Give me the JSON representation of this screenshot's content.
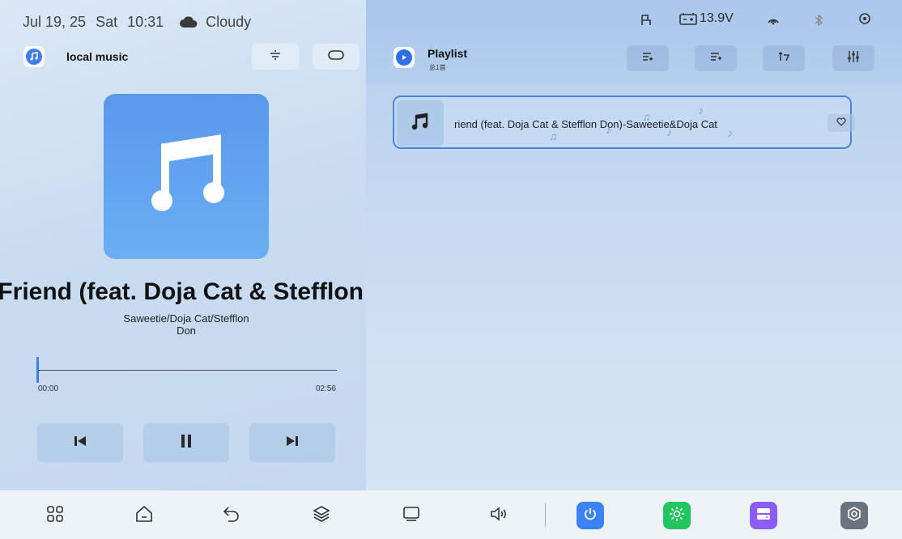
{
  "status_bar": {
    "date": "Jul 19, 25",
    "day": "Sat",
    "time": "10:31",
    "weather": "Cloudy",
    "voltage": "13.9V"
  },
  "left_header": {
    "title": "local music"
  },
  "right_header": {
    "title": "Playlist",
    "subtitle": "总1首"
  },
  "now_playing": {
    "title": "t Friend (feat. Doja Cat & Stefflon",
    "artist_line1": "Saweetie/Doja Cat/Stefflon",
    "artist_line2": "Don",
    "elapsed": "00:00",
    "duration": "02:56",
    "progress": 0.0
  },
  "playlist": {
    "items": [
      {
        "label": "riend (feat. Doja Cat & Stefflon Don)-Saweetie&Doja Cat"
      }
    ]
  },
  "icons": {
    "left_header": [
      "menu-lines-icon",
      "repeat-loop-icon"
    ],
    "right_header": [
      "favorite-list-icon",
      "add-list-icon",
      "sort-icon",
      "equalizer-icon"
    ],
    "transport": [
      "previous-icon",
      "pause-icon",
      "next-icon"
    ],
    "dock": [
      "apps-grid-icon",
      "home-icon",
      "back-icon",
      "layers-icon",
      "screen-icon",
      "volume-icon",
      "power-icon",
      "brightness-icon",
      "storage-icon",
      "settings-icon"
    ]
  },
  "colors": {
    "accent": "#3f7cf0",
    "power_tile": "#3b82f6",
    "brightness_tile": "#22c55e",
    "storage_tile": "#8b5cf6",
    "settings_tile": "#6b7280"
  }
}
